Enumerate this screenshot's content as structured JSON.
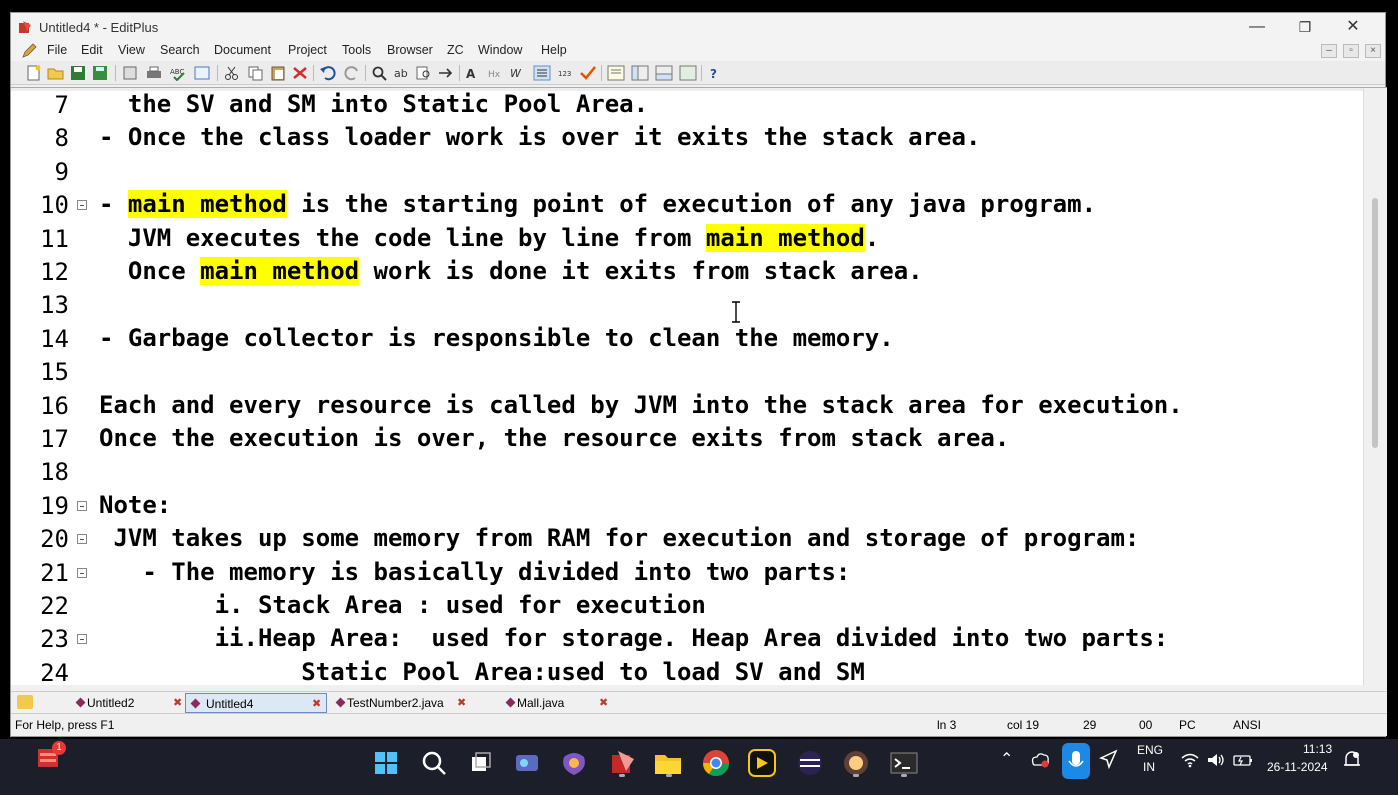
{
  "window": {
    "title": "Untitled4 * - EditPlus"
  },
  "menu": [
    "File",
    "Edit",
    "View",
    "Search",
    "Document",
    "Project",
    "Tools",
    "Browser",
    "ZC",
    "Window",
    "Help"
  ],
  "editor": {
    "lines": [
      {
        "num": "7",
        "fold": false,
        "segments": [
          {
            "t": "  the SV and SM into Static Pool Area.",
            "h": false
          }
        ]
      },
      {
        "num": "8",
        "fold": false,
        "segments": [
          {
            "t": "- Once the class loader work is over it exits the stack area.",
            "h": false
          }
        ]
      },
      {
        "num": "9",
        "fold": false,
        "segments": []
      },
      {
        "num": "10",
        "fold": true,
        "segments": [
          {
            "t": "- ",
            "h": false
          },
          {
            "t": "main method",
            "h": true
          },
          {
            "t": " is the starting point of execution of any java program.",
            "h": false
          }
        ]
      },
      {
        "num": "11",
        "fold": false,
        "segments": [
          {
            "t": "  JVM executes the code line by line from ",
            "h": false
          },
          {
            "t": "main method",
            "h": true
          },
          {
            "t": ".",
            "h": false
          }
        ]
      },
      {
        "num": "12",
        "fold": false,
        "segments": [
          {
            "t": "  Once ",
            "h": false
          },
          {
            "t": "main method",
            "h": true
          },
          {
            "t": " work is done it exits from stack area.",
            "h": false
          }
        ]
      },
      {
        "num": "13",
        "fold": false,
        "segments": []
      },
      {
        "num": "14",
        "fold": false,
        "segments": [
          {
            "t": "- Garbage collector is responsible to clean the memory.",
            "h": false
          }
        ]
      },
      {
        "num": "15",
        "fold": false,
        "segments": []
      },
      {
        "num": "16",
        "fold": false,
        "segments": [
          {
            "t": "Each and every resource is called by JVM into the stack area for execution.",
            "h": false
          }
        ]
      },
      {
        "num": "17",
        "fold": false,
        "segments": [
          {
            "t": "Once the execution is over, the resource exits from stack area.",
            "h": false
          }
        ]
      },
      {
        "num": "18",
        "fold": false,
        "segments": []
      },
      {
        "num": "19",
        "fold": true,
        "segments": [
          {
            "t": "Note:",
            "h": false
          }
        ]
      },
      {
        "num": "20",
        "fold": true,
        "segments": [
          {
            "t": " JVM takes up some memory from RAM for execution and storage of program:",
            "h": false
          }
        ]
      },
      {
        "num": "21",
        "fold": true,
        "segments": [
          {
            "t": "   - The memory is basically divided into two parts:",
            "h": false
          }
        ]
      },
      {
        "num": "22",
        "fold": false,
        "segments": [
          {
            "t": "        i. Stack Area : used for execution",
            "h": false
          }
        ]
      },
      {
        "num": "23",
        "fold": true,
        "segments": [
          {
            "t": "        ii.Heap Area:  used for storage. Heap Area divided into two parts:",
            "h": false
          }
        ]
      },
      {
        "num": "24",
        "fold": false,
        "segments": [
          {
            "t": "              Static Pool Area:used to load SV and SM",
            "h": false
          }
        ]
      }
    ]
  },
  "tabs": [
    {
      "label": "Untitled2",
      "active": false
    },
    {
      "label": "Untitled4",
      "active": true
    },
    {
      "label": "TestNumber2.java",
      "active": false
    },
    {
      "label": "Mall.java",
      "active": false
    }
  ],
  "status": {
    "help": "For Help, press F1",
    "ln": "ln 3",
    "col": "col 19",
    "chars": "29",
    "code": "00",
    "mode": "PC",
    "encoding": "ANSI"
  },
  "taskbar": {
    "badge": "1",
    "lang_top": "ENG",
    "lang_bottom": "IN",
    "time": "11:13",
    "date": "26-11-2024"
  }
}
